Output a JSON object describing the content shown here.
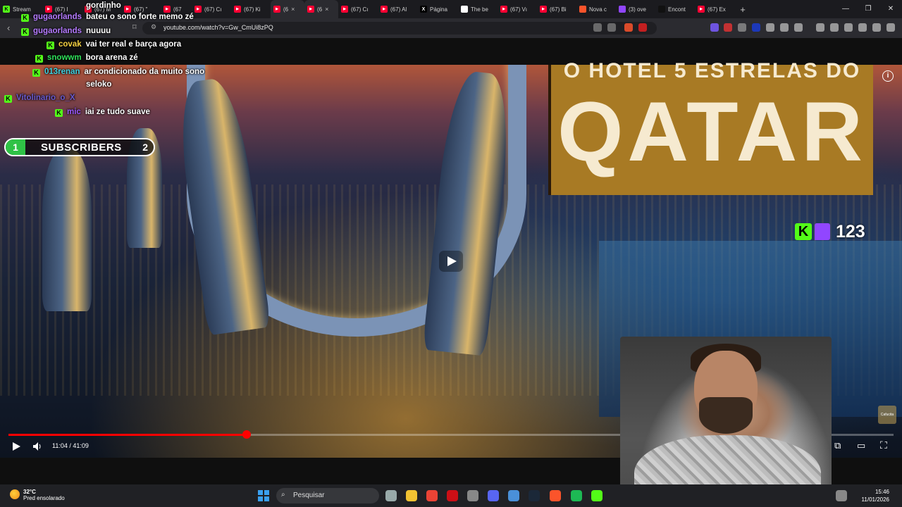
{
  "browser": {
    "tabs": [
      {
        "label": "Stream",
        "fav": "kick-logo-icon",
        "color": "#53fc18"
      },
      {
        "label": "(67) I",
        "fav": "youtube-icon",
        "color": "#ff0033"
      },
      {
        "label": "(67) M",
        "fav": "youtube-icon",
        "color": "#ff0033"
      },
      {
        "label": "(67) \"",
        "fav": "youtube-icon",
        "color": "#ff0033"
      },
      {
        "label": "(67",
        "fav": "youtube-icon",
        "color": "#ff0033"
      },
      {
        "label": "(67) Cı",
        "fav": "youtube-icon",
        "color": "#ff0033"
      },
      {
        "label": "(67) Ki",
        "fav": "youtube-icon",
        "color": "#ff0033"
      },
      {
        "label": "(6",
        "fav": "youtube-icon",
        "color": "#ff0033"
      },
      {
        "label": "(6",
        "fav": "youtube-icon",
        "color": "#ff0033"
      },
      {
        "label": "(67) Cı",
        "fav": "youtube-icon",
        "color": "#ff0033"
      },
      {
        "label": "(67) Al",
        "fav": "youtube-icon",
        "color": "#ff0033"
      },
      {
        "label": "Página",
        "fav": "x-logo-icon",
        "color": "#000000"
      },
      {
        "label": "The be",
        "fav": "diamond-icon",
        "color": "#ffffff"
      },
      {
        "label": "(67) Vı",
        "fav": "youtube-icon",
        "color": "#ff0033"
      },
      {
        "label": "(67) Bi",
        "fav": "youtube-icon",
        "color": "#ff0033"
      },
      {
        "label": "Nova c",
        "fav": "brave-icon",
        "color": "#fb542b"
      },
      {
        "label": "(3) ove",
        "fav": "twitch-icon",
        "color": "#9146ff"
      },
      {
        "label": "Encont",
        "fav": "tiktok-icon",
        "color": "#111111"
      },
      {
        "label": "(67) Ex",
        "fav": "youtube-icon",
        "color": "#ff0033"
      }
    ],
    "url": "youtube.com/watch?v=Gw_CmUi8zPQ"
  },
  "chat": [
    {
      "user": "",
      "message": "gordinho",
      "user_color": "#ffffff",
      "badge": false
    },
    {
      "user": "gugaorlands",
      "message": "bateu o sono forte memo zé",
      "user_color": "#b57bff",
      "badge": true
    },
    {
      "user": "gugaorlands",
      "message": "nuuuu",
      "user_color": "#b57bff",
      "badge": true
    },
    {
      "user": "covak",
      "message": "vai ter real e barça agora",
      "user_color": "#f5d142",
      "badge": true
    },
    {
      "user": "snowwm",
      "message": "bora arena zé",
      "user_color": "#2fe05a",
      "badge": true
    },
    {
      "user": "013renan",
      "message": "ar condicionado da muito sono",
      "user_color": "#3fd1e0",
      "badge": true
    },
    {
      "user": "",
      "message": "seloko",
      "user_color": "#ffffff",
      "badge": false
    },
    {
      "user": "Vitolinario_o_X",
      "message": "",
      "user_color": "#6a5acd",
      "badge": true
    },
    {
      "user": "mic",
      "message": "iai ze tudo suave",
      "user_color": "#9b59ff",
      "badge": true
    }
  ],
  "overlay": {
    "title_top": "O HOTEL 5 ESTRELAS DO",
    "title_main": "QATAR",
    "subscribers_goal_left": "1",
    "subscribers_label": "SUBSCRIBERS",
    "subscribers_goal_right": "2",
    "viewer_count": "123",
    "watermark": "Cafucita"
  },
  "player": {
    "current_time": "11:04",
    "duration": "41:09",
    "progress": 0.269,
    "time_display": "11:04 / 41:09"
  },
  "taskbar": {
    "temperature": "32°C",
    "weather": "Pred ensolarado",
    "search_placeholder": "Pesquisar",
    "time": "15:46",
    "date": "11/01/2026"
  }
}
